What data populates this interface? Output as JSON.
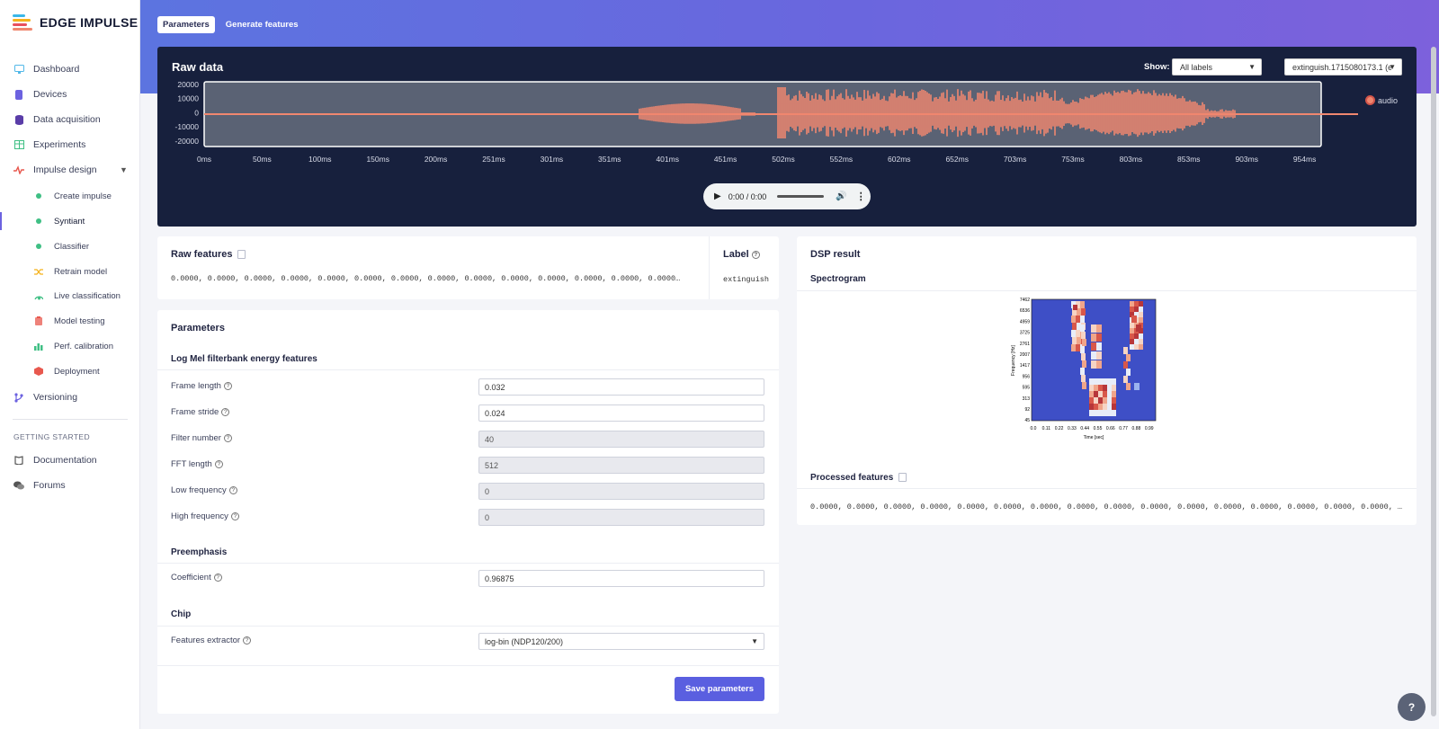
{
  "app": {
    "brand": "EDGE IMPULSE"
  },
  "sidebar": {
    "items": [
      {
        "label": "Dashboard"
      },
      {
        "label": "Devices"
      },
      {
        "label": "Data acquisition"
      },
      {
        "label": "Experiments"
      },
      {
        "label": "Impulse design"
      },
      {
        "label": "Versioning"
      }
    ],
    "impulse_sub": [
      {
        "label": "Create impulse"
      },
      {
        "label": "Syntiant"
      },
      {
        "label": "Classifier"
      },
      {
        "label": "Retrain model"
      },
      {
        "label": "Live classification"
      },
      {
        "label": "Model testing"
      },
      {
        "label": "Perf. calibration"
      },
      {
        "label": "Deployment"
      }
    ],
    "getting_started_title": "GETTING STARTED",
    "getting_started": [
      {
        "label": "Documentation"
      },
      {
        "label": "Forums"
      }
    ]
  },
  "tabs": [
    {
      "label": "Parameters",
      "active": true
    },
    {
      "label": "Generate features",
      "active": false
    }
  ],
  "raw_data": {
    "title": "Raw data",
    "show_label": "Show:",
    "show_value": "All labels",
    "sample_value": "extinguish.1715080173.1 (e",
    "y_ticks": [
      "20000",
      "10000",
      "0",
      "-10000",
      "-20000"
    ],
    "x_ticks": [
      "0ms",
      "50ms",
      "100ms",
      "150ms",
      "200ms",
      "251ms",
      "301ms",
      "351ms",
      "401ms",
      "451ms",
      "502ms",
      "552ms",
      "602ms",
      "652ms",
      "703ms",
      "753ms",
      "803ms",
      "853ms",
      "903ms",
      "954ms"
    ],
    "legend": "audio",
    "audio_time": "0:00 / 0:00",
    "colors": {
      "wave": "#f0876f",
      "background": "#17203d"
    }
  },
  "raw_features": {
    "title": "Raw features",
    "values": "0.0000, 0.0000, 0.0000, 0.0000, 0.0000, 0.0000, 0.0000, 0.0000, 0.0000, 0.0000, 0.0000, 0.0000, 0.0000, 0.0000, 0.0000, 0.0000…",
    "label_title": "Label",
    "label_value": "extinguish"
  },
  "parameters": {
    "title": "Parameters",
    "group1": "Log Mel filterbank energy features",
    "fields": [
      {
        "label": "Frame length",
        "value": "0.032",
        "disabled": false
      },
      {
        "label": "Frame stride",
        "value": "0.024",
        "disabled": false
      },
      {
        "label": "Filter number",
        "value": "40",
        "disabled": true
      },
      {
        "label": "FFT length",
        "value": "512",
        "disabled": true
      },
      {
        "label": "Low frequency",
        "value": "0",
        "disabled": true
      },
      {
        "label": "High frequency",
        "value": "0",
        "disabled": true
      }
    ],
    "group2": "Preemphasis",
    "coefficient_label": "Coefficient",
    "coefficient_value": "0.96875",
    "group3": "Chip",
    "extractor_label": "Features extractor",
    "extractor_value": "log-bin (NDP120/200)",
    "save_label": "Save parameters"
  },
  "dsp": {
    "title": "DSP result",
    "spectrogram_title": "Spectrogram",
    "y_ticks": [
      "7462",
      "6536",
      "4959",
      "3725",
      "2761",
      "2007",
      "1417",
      "956",
      "595",
      "313",
      "92",
      "45"
    ],
    "x_ticks": [
      "0.0",
      "0.11",
      "0.22",
      "0.33",
      "0.44",
      "0.55",
      "0.66",
      "0.77",
      "0.88",
      "0.99"
    ],
    "ylabel": "Frequency [Hz]",
    "xlabel": "Time [sec]",
    "processed_title": "Processed features",
    "processed_values": "0.0000, 0.0000, 0.0000, 0.0000, 0.0000, 0.0000, 0.0000, 0.0000, 0.0000, 0.0000, 0.0000, 0.0000, 0.0000, 0.0000, 0.0000, 0.0000, 0.0000, 0.0000, …"
  },
  "help_fab": "?"
}
